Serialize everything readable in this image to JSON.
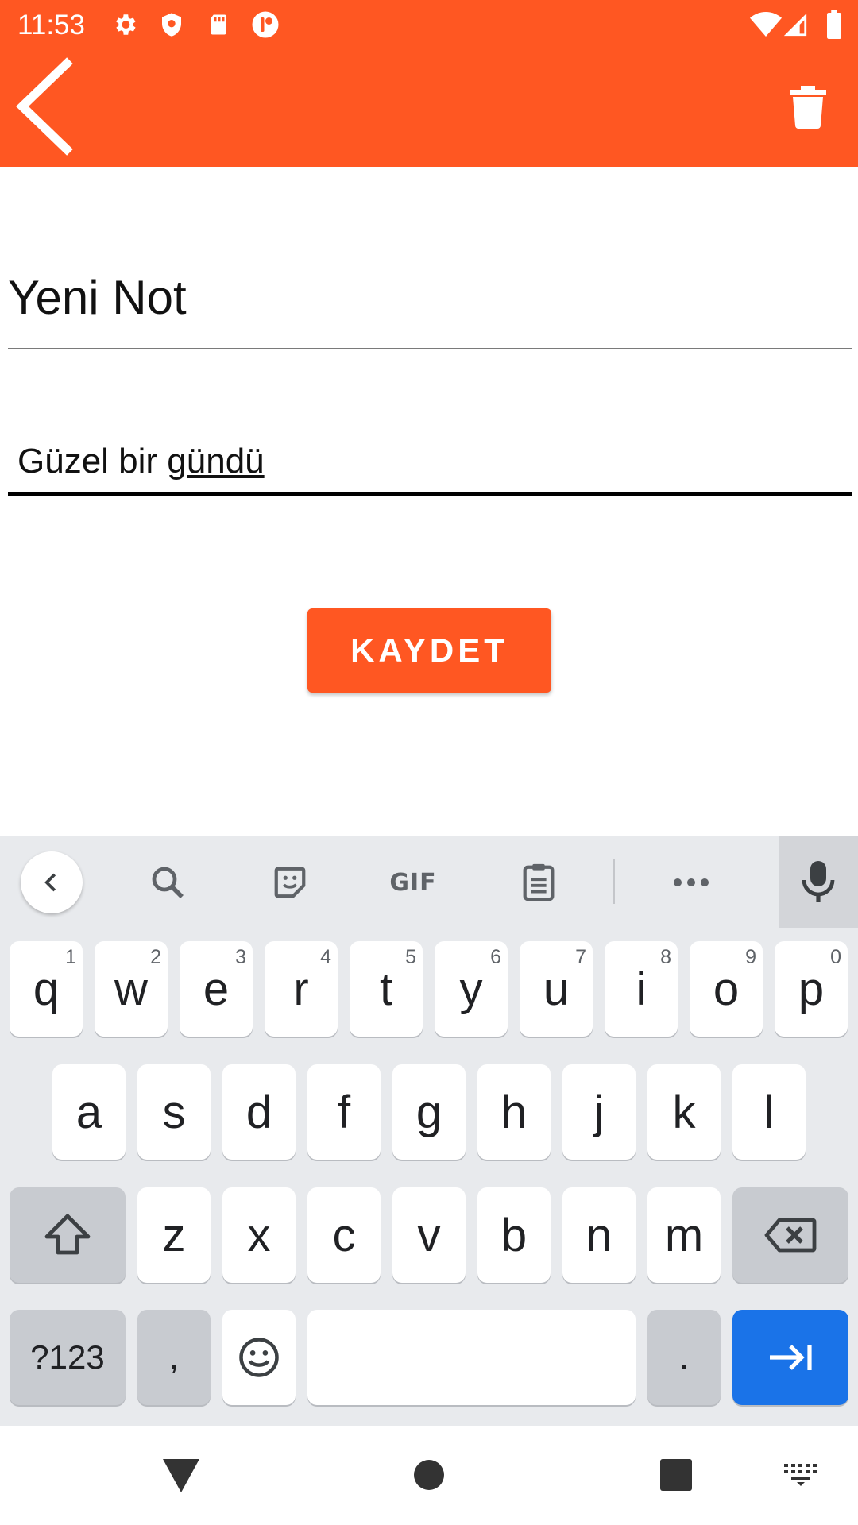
{
  "status_bar": {
    "time": "11:53",
    "left_icons": [
      "gear-icon",
      "shield-icon",
      "sd-card-icon",
      "notification-app-icon"
    ],
    "right_icons": [
      "wifi-icon",
      "cellular-signal-icon",
      "battery-icon"
    ]
  },
  "app_bar": {
    "color": "#FF5722",
    "back_icon": "chevron-left-icon",
    "delete_icon": "trash-icon"
  },
  "form": {
    "title_value": "Yeni Not",
    "body_value_plain": "Güzel bir ",
    "body_value_composing": "gündü",
    "save_label": "KAYDET"
  },
  "keyboard": {
    "toolbar": [
      "back-icon",
      "search-icon",
      "sticker-icon",
      "gif-icon",
      "clipboard-icon",
      "more-icon",
      "mic-icon"
    ],
    "gif_label": "GIF",
    "row1": [
      {
        "label": "q",
        "hint": "1"
      },
      {
        "label": "w",
        "hint": "2"
      },
      {
        "label": "e",
        "hint": "3"
      },
      {
        "label": "r",
        "hint": "4"
      },
      {
        "label": "t",
        "hint": "5"
      },
      {
        "label": "y",
        "hint": "6"
      },
      {
        "label": "u",
        "hint": "7"
      },
      {
        "label": "i",
        "hint": "8"
      },
      {
        "label": "o",
        "hint": "9"
      },
      {
        "label": "p",
        "hint": "0"
      }
    ],
    "row2": [
      "a",
      "s",
      "d",
      "f",
      "g",
      "h",
      "j",
      "k",
      "l"
    ],
    "row3": [
      "z",
      "x",
      "c",
      "v",
      "b",
      "n",
      "m"
    ],
    "symbols_label": "?123",
    "comma_label": ",",
    "period_label": ".",
    "action_color": "#1A73E8"
  },
  "nav_bar": {
    "icons": [
      "back-triangle-icon",
      "home-circle-icon",
      "recents-square-icon",
      "keyboard-switch-icon"
    ]
  }
}
